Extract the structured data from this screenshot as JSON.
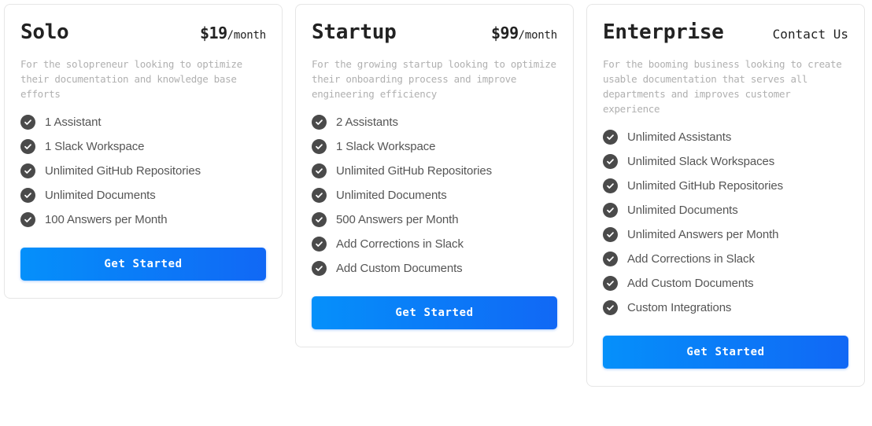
{
  "plans": [
    {
      "name": "Solo",
      "price_amount": "$19",
      "price_period": "/month",
      "description": "For the solopreneur looking to optimize their documentation and knowledge base efforts",
      "features": [
        "1 Assistant",
        "1 Slack Workspace",
        "Unlimited GitHub Repositories",
        "Unlimited Documents",
        "100 Answers per Month"
      ],
      "cta_label": "Get Started"
    },
    {
      "name": "Startup",
      "price_amount": "$99",
      "price_period": "/month",
      "description": "For the growing startup looking to optimize their onboarding process and improve engineering efficiency",
      "features": [
        "2 Assistants",
        "1 Slack Workspace",
        "Unlimited GitHub Repositories",
        "Unlimited Documents",
        "500 Answers per Month",
        "Add Corrections in Slack",
        "Add Custom Documents"
      ],
      "cta_label": "Get Started"
    },
    {
      "name": "Enterprise",
      "price_amount": "Contact Us",
      "price_period": "",
      "description": "For the booming business looking to create usable documentation that serves all departments and improves customer experience",
      "features": [
        "Unlimited Assistants",
        "Unlimited Slack Workspaces",
        "Unlimited GitHub Repositories",
        "Unlimited Documents",
        "Unlimited Answers per Month",
        "Add Corrections in Slack",
        "Add Custom Documents",
        "Custom Integrations"
      ],
      "cta_label": "Get Started"
    }
  ],
  "icons": {
    "check": "check-circle-icon"
  },
  "colors": {
    "cta_gradient_start": "#0590fa",
    "cta_gradient_end": "#1168f5",
    "check_badge": "#4a4a4a",
    "card_border": "#e6e6e6",
    "heading": "#222222",
    "description": "#b0b0b0",
    "feature_text": "#555555"
  }
}
